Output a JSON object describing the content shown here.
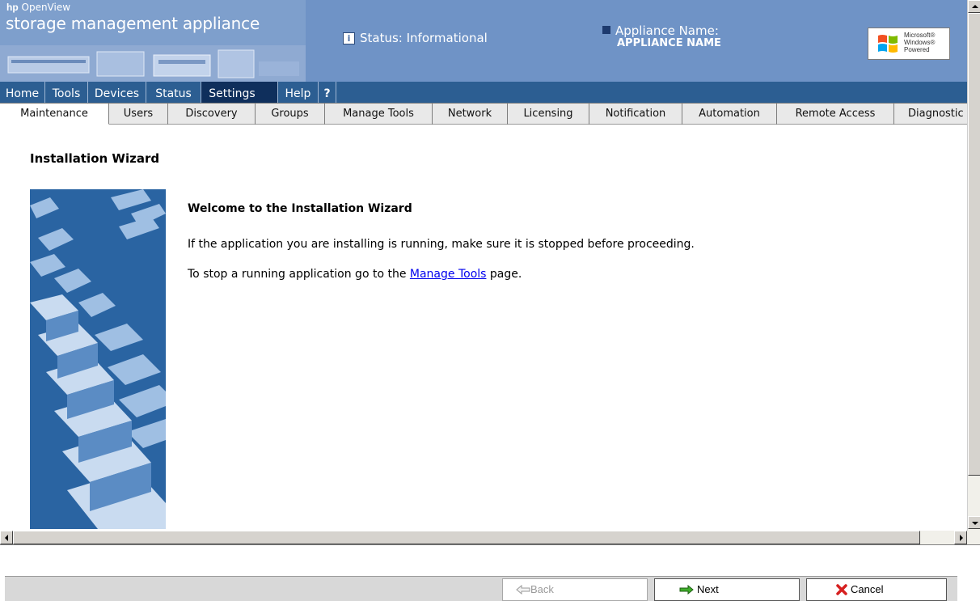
{
  "header": {
    "brand_prefix": "hp",
    "brand_product": "OpenView",
    "app_title": "storage management appliance",
    "status_text": "Status: Informational",
    "appliance_label": "Appliance Name:",
    "appliance_name": "APPLIANCE NAME",
    "win_logo_lines": [
      "Microsoft®",
      "Windows®",
      "Powered"
    ]
  },
  "top_nav": [
    {
      "label": "Home"
    },
    {
      "label": "Tools"
    },
    {
      "label": "Devices"
    },
    {
      "label": "Status"
    },
    {
      "label": "Settings"
    },
    {
      "label": "Help"
    },
    {
      "label": "?"
    }
  ],
  "top_nav_active": "Settings",
  "sub_nav": [
    {
      "label": "Maintenance"
    },
    {
      "label": "Users"
    },
    {
      "label": "Discovery"
    },
    {
      "label": "Groups"
    },
    {
      "label": "Manage Tools"
    },
    {
      "label": "Network"
    },
    {
      "label": "Licensing"
    },
    {
      "label": "Notification"
    },
    {
      "label": "Automation"
    },
    {
      "label": "Remote Access"
    },
    {
      "label": "Diagnostic"
    }
  ],
  "sub_nav_active": "Maintenance",
  "main": {
    "title": "Installation Wizard",
    "welcome": "Welcome to the Installation Wizard",
    "para1": "If the application you are installing is running, make sure it is stopped before proceeding.",
    "para2_before": "To stop a running application go to the",
    "para2_link": "Manage Tools",
    "para2_after": "page."
  },
  "footer": {
    "back_label": "Back",
    "next_label": "Next",
    "cancel_label": "Cancel",
    "back_enabled": false
  },
  "colors": {
    "header_bg": "#6f93c6",
    "nav_bg": "#2c5e92",
    "nav_active": "#0f2f5c",
    "sidebar_bg": "#2a64a2",
    "link": "#0000ee"
  }
}
